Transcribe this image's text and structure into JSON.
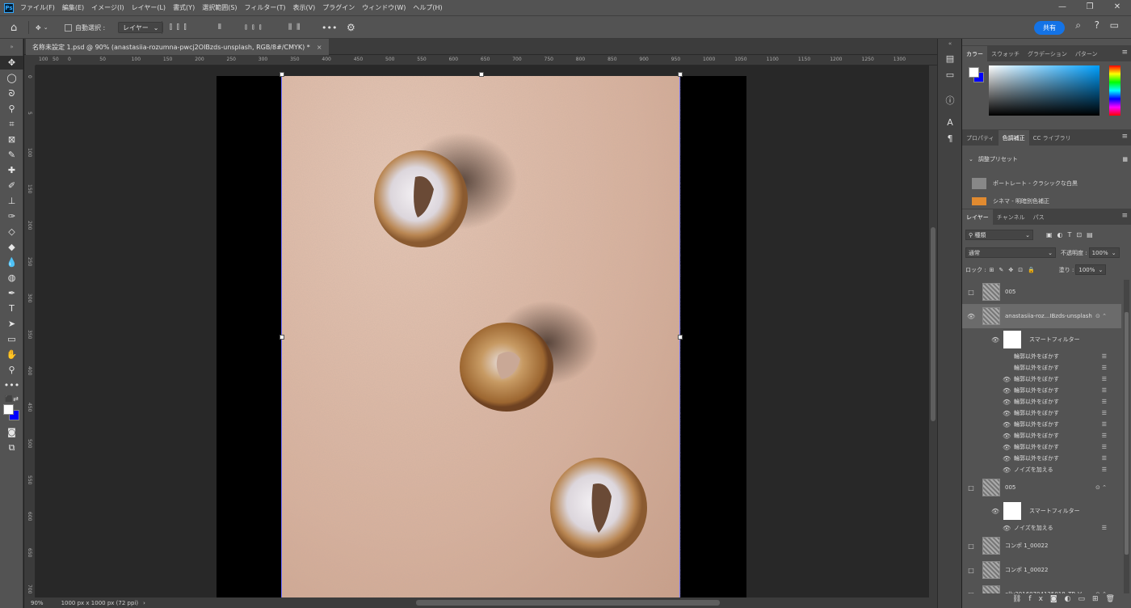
{
  "menu": [
    "ファイル(F)",
    "編集(E)",
    "イメージ(I)",
    "レイヤー(L)",
    "書式(Y)",
    "選択範囲(S)",
    "フィルター(T)",
    "表示(V)",
    "プラグイン",
    "ウィンドウ(W)",
    "ヘルプ(H)"
  ],
  "options": {
    "auto_select": "自動選択 :",
    "target": "レイヤー",
    "share": "共有"
  },
  "document_tab": {
    "title": "名称未設定 1.psd @ 90% (anastasiia-rozumna-pwcj2OIBzds-unsplash, RGB/8#/CMYK) *",
    "close": "×"
  },
  "ruler_h": [
    "0",
    "50",
    "100",
    "150",
    "200",
    "250",
    "300",
    "350",
    "400",
    "450",
    "500",
    "550",
    "600",
    "650",
    "700",
    "750",
    "800",
    "850",
    "900",
    "950",
    "1000",
    "1050",
    "1100",
    "1150",
    "1200",
    "1250",
    "1300"
  ],
  "ruler_h_neg": [
    "100",
    "50"
  ],
  "ruler_v": [
    "0",
    "5",
    "1\n0\n0",
    "1\n5\n0",
    "2\n0\n0",
    "2\n5\n0",
    "3\n0\n0",
    "3\n5\n0",
    "4\n0\n0",
    "4\n5\n0",
    "5\n0\n0",
    "5\n5\n0",
    "6\n0\n0",
    "6\n5\n0",
    "7\n0\n0"
  ],
  "status": {
    "zoom": "90%",
    "size": "1000 px x 1000 px (72 ppi)"
  },
  "color_panel": {
    "tabs": [
      "カラー",
      "スウォッチ",
      "グラデーション",
      "パターン"
    ]
  },
  "props_panel": {
    "tabs": [
      "プロパティ",
      "色調補正",
      "CC ライブラリ"
    ],
    "section": "調整プリセット",
    "presets": [
      "ポートレート - クラシックな白黒",
      "シネマ - 明暗別色補正"
    ]
  },
  "layers_panel": {
    "tabs": [
      "レイヤー",
      "チャンネル",
      "パス"
    ],
    "filter_kind": "種類",
    "blend": "通常",
    "opacity_label": "不透明度 :",
    "opacity": "100%",
    "lock_label": "ロック :",
    "fill_label": "塗り :",
    "fill": "100%",
    "layers": [
      {
        "name": "005",
        "visible": false
      },
      {
        "name": "anastasiia-roz...IBzds-unsplash",
        "visible": true,
        "selected": true
      },
      {
        "name": "スマートフィルター",
        "type": "sf"
      },
      {
        "name": "輪郭以外をぼかす",
        "type": "f",
        "visible": false
      },
      {
        "name": "輪郭以外をぼかす",
        "type": "f",
        "visible": false
      },
      {
        "name": "輪郭以外をぼかす",
        "type": "f",
        "visible": true
      },
      {
        "name": "輪郭以外をぼかす",
        "type": "f",
        "visible": true
      },
      {
        "name": "輪郭以外をぼかす",
        "type": "f",
        "visible": true
      },
      {
        "name": "輪郭以外をぼかす",
        "type": "f",
        "visible": true
      },
      {
        "name": "輪郭以外をぼかす",
        "type": "f",
        "visible": true
      },
      {
        "name": "輪郭以外をぼかす",
        "type": "f",
        "visible": true
      },
      {
        "name": "輪郭以外をぼかす",
        "type": "f",
        "visible": true
      },
      {
        "name": "輪郭以外をぼかす",
        "type": "f",
        "visible": true
      },
      {
        "name": "ノイズを加える",
        "type": "f",
        "visible": true
      },
      {
        "name": "005",
        "visible": false
      },
      {
        "name": "スマートフィルター",
        "type": "sf"
      },
      {
        "name": "ノイズを加える",
        "type": "f",
        "visible": true
      },
      {
        "name": "コンポ 1_00022",
        "visible": false
      },
      {
        "name": "コンポ 1_00022",
        "visible": false
      },
      {
        "name": "elly20160704125018_TP_V",
        "visible": false
      }
    ]
  },
  "colors": {
    "accent": "#1473e6",
    "fg": "#ffffff",
    "bg": "#0000ff",
    "selection": "#6a6aff"
  }
}
